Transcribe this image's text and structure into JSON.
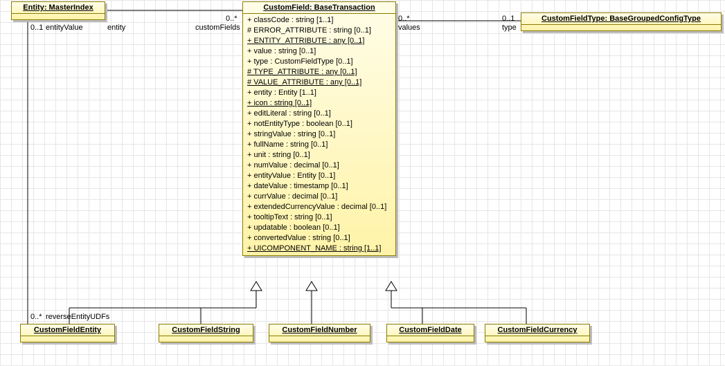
{
  "entity_master": {
    "title": "Entity: MasterIndex"
  },
  "custom_field": {
    "title": "CustomField: BaseTransaction",
    "attrs": [
      {
        "t": "+ classCode : string [1..1]",
        "u": false
      },
      {
        "t": "# ERROR_ATTRIBUTE : string [0..1]",
        "u": false
      },
      {
        "t": "+ ENTITY_ATTRIBUTE : any [0..1]",
        "u": true
      },
      {
        "t": "+ value : string [0..1]",
        "u": false
      },
      {
        "t": "+ type : CustomFieldType [0..1]",
        "u": false
      },
      {
        "t": "# TYPE_ATTRIBUTE : any [0..1]",
        "u": true
      },
      {
        "t": "# VALUE_ATTRIBUTE : any [0..1]",
        "u": true
      },
      {
        "t": "+ entity : Entity [1..1]",
        "u": false
      },
      {
        "t": "+ icon : string [0..1]",
        "u": true
      },
      {
        "t": "+ editLiteral : string [0..1]",
        "u": false
      },
      {
        "t": "+ notEntityType : boolean [0..1]",
        "u": false
      },
      {
        "t": "+ stringValue : string [0..1]",
        "u": false
      },
      {
        "t": "+ fullName : string [0..1]",
        "u": false
      },
      {
        "t": "+ unit : string [0..1]",
        "u": false
      },
      {
        "t": "+ numValue : decimal [0..1]",
        "u": false
      },
      {
        "t": "+ entityValue : Entity [0..1]",
        "u": false
      },
      {
        "t": "+ dateValue : timestamp [0..1]",
        "u": false
      },
      {
        "t": "+ currValue : decimal [0..1]",
        "u": false
      },
      {
        "t": "+ extendedCurrencyValue : decimal [0..1]",
        "u": false
      },
      {
        "t": "+ tooltipText : string [0..1]",
        "u": false
      },
      {
        "t": "+ updatable : boolean [0..1]",
        "u": false
      },
      {
        "t": "+ convertedValue : string [0..1]",
        "u": false
      },
      {
        "t": "+ UICOMPONENT_NAME : string [1..1]",
        "u": true
      }
    ]
  },
  "custom_field_type": {
    "title": "CustomFieldType: BaseGroupedConfigType"
  },
  "subclasses": {
    "entity": "CustomFieldEntity",
    "string": "CustomFieldString",
    "number": "CustomFieldNumber",
    "date": "CustomFieldDate",
    "currency": "CustomFieldCurrency"
  },
  "labels": {
    "m_0_1_left": "0..1",
    "m_0_star_a": "0..*",
    "m_0_star_b": "0..*",
    "m_0_1_right": "0..1",
    "m_0_star_rev": "0..*",
    "entityValue": "entityValue",
    "entity": "entity",
    "customFields": "customFields",
    "values": "values",
    "type": "type",
    "reverseEntityUDFs": "reverseEntityUDFs"
  },
  "chart_data": {
    "type": "table",
    "kind": "uml-class-diagram",
    "classes": [
      {
        "name": "Entity",
        "stereotype": "MasterIndex"
      },
      {
        "name": "CustomField",
        "stereotype": "BaseTransaction",
        "attributes": [
          "classCode:string[1..1]",
          "ERROR_ATTRIBUTE:string[0..1]",
          "ENTITY_ATTRIBUTE:any[0..1]",
          "value:string[0..1]",
          "type:CustomFieldType[0..1]",
          "TYPE_ATTRIBUTE:any[0..1]",
          "VALUE_ATTRIBUTE:any[0..1]",
          "entity:Entity[1..1]",
          "icon:string[0..1]",
          "editLiteral:string[0..1]",
          "notEntityType:boolean[0..1]",
          "stringValue:string[0..1]",
          "fullName:string[0..1]",
          "unit:string[0..1]",
          "numValue:decimal[0..1]",
          "entityValue:Entity[0..1]",
          "dateValue:timestamp[0..1]",
          "currValue:decimal[0..1]",
          "extendedCurrencyValue:decimal[0..1]",
          "tooltipText:string[0..1]",
          "updatable:boolean[0..1]",
          "convertedValue:string[0..1]",
          "UICOMPONENT_NAME:string[1..1]"
        ]
      },
      {
        "name": "CustomFieldType",
        "stereotype": "BaseGroupedConfigType"
      },
      {
        "name": "CustomFieldEntity"
      },
      {
        "name": "CustomFieldString"
      },
      {
        "name": "CustomFieldNumber"
      },
      {
        "name": "CustomFieldDate"
      },
      {
        "name": "CustomFieldCurrency"
      }
    ],
    "associations": [
      {
        "from": "CustomField",
        "to": "Entity",
        "fromRole": "customFields",
        "fromMult": "0..*",
        "toRole": "entity"
      },
      {
        "from": "Entity",
        "to": "CustomField",
        "fromRole": "entityValue",
        "fromMult": "0..1"
      },
      {
        "from": "CustomField",
        "to": "CustomFieldType",
        "fromRole": "values",
        "fromMult": "0..*",
        "toRole": "type",
        "toMult": "0..1"
      },
      {
        "from": "Entity",
        "to": "CustomFieldEntity",
        "fromRole": "reverseEntityUDFs",
        "toMult": "0..*"
      }
    ],
    "generalizations": [
      {
        "child": "CustomFieldEntity",
        "parent": "CustomField"
      },
      {
        "child": "CustomFieldString",
        "parent": "CustomField"
      },
      {
        "child": "CustomFieldNumber",
        "parent": "CustomField"
      },
      {
        "child": "CustomFieldDate",
        "parent": "CustomField"
      },
      {
        "child": "CustomFieldCurrency",
        "parent": "CustomField"
      }
    ]
  }
}
